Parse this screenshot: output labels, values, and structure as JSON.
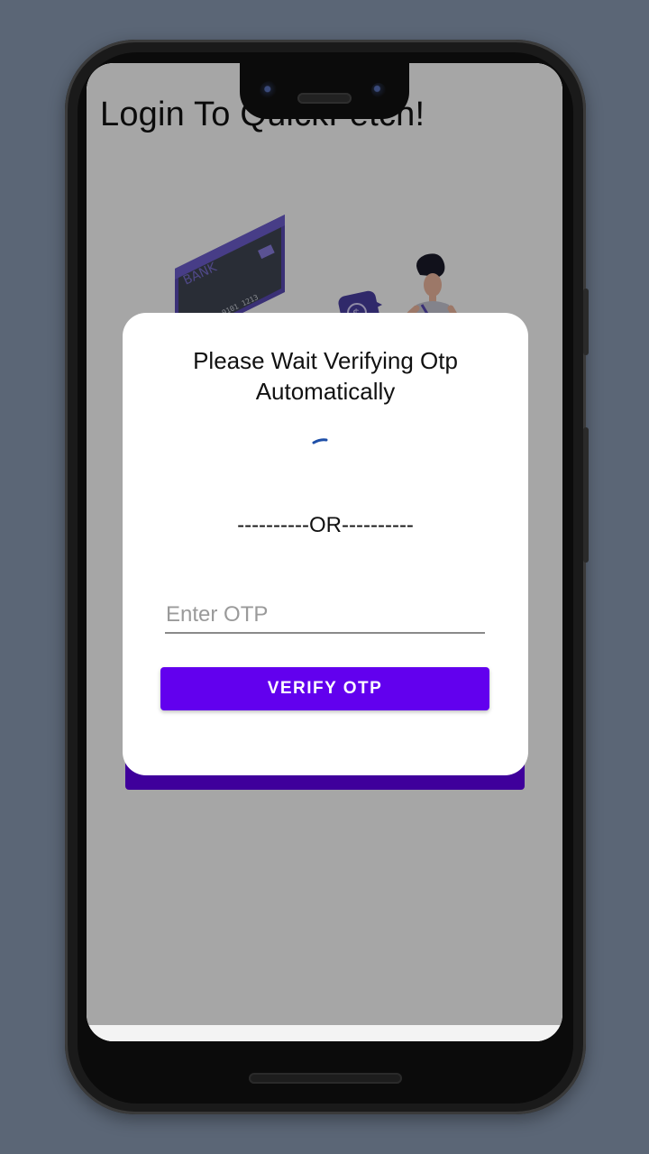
{
  "app": {
    "title": "Login To QuickFetch!"
  },
  "illustration": {
    "card_bank_label": "BANK",
    "card_number": "5678 9101 1213"
  },
  "dialog": {
    "message": "Please Wait Verifying Otp Automatically",
    "divider": "----------OR----------",
    "otp_placeholder": "Enter OTP",
    "otp_value": "",
    "verify_label": "VERIFY OTP"
  },
  "colors": {
    "primary": "#6200ee",
    "background": "#5b6676",
    "spinner": "#1e4fa8"
  },
  "icons": {
    "spinner": "progress-spinner-icon"
  }
}
